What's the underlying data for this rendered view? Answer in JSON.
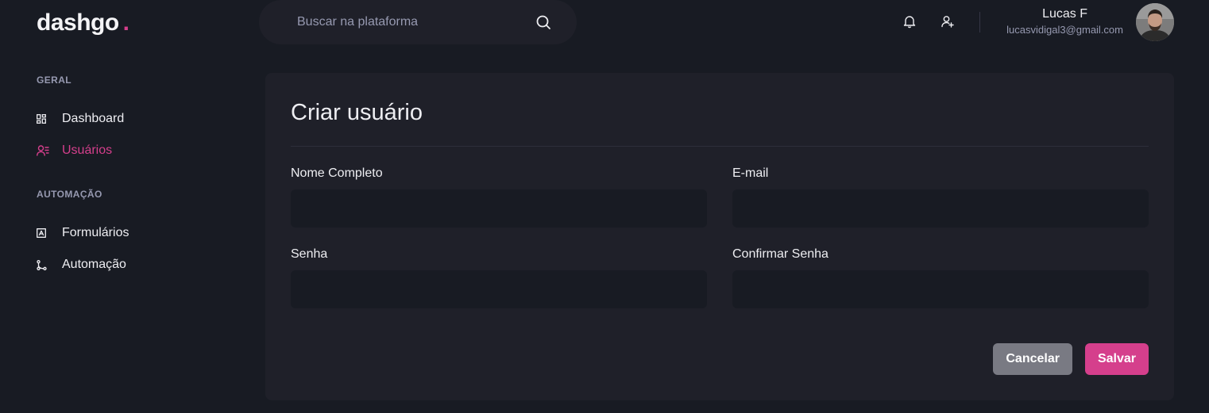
{
  "logo": {
    "text": "dashgo",
    "dot": "."
  },
  "search": {
    "placeholder": "Buscar na plataforma",
    "icon": "search-icon"
  },
  "header": {
    "icons": [
      "bell-icon",
      "user-add-icon"
    ]
  },
  "profile": {
    "name": "Lucas F",
    "email": "lucasvidigal3@gmail.com"
  },
  "sidebar": {
    "sections": [
      {
        "title": "GERAL",
        "items": [
          {
            "label": "Dashboard",
            "icon": "dashboard-icon"
          },
          {
            "label": "Usuários",
            "icon": "users-icon",
            "active": true
          }
        ]
      },
      {
        "title": "AUTOMAÇÃO",
        "items": [
          {
            "label": "Formulários",
            "icon": "form-icon"
          },
          {
            "label": "Automação",
            "icon": "git-branch-icon"
          }
        ]
      }
    ]
  },
  "form": {
    "title": "Criar usuário",
    "fields": {
      "name": {
        "label": "Nome Completo",
        "value": ""
      },
      "email": {
        "label": "E-mail",
        "value": ""
      },
      "password": {
        "label": "Senha",
        "value": ""
      },
      "password_confirm": {
        "label": "Confirmar Senha",
        "value": ""
      }
    },
    "cancel_label": "Cancelar",
    "save_label": "Salvar"
  },
  "colors": {
    "accent": "#d53f8c",
    "background": "#181b23",
    "card": "#1f2029",
    "muted": "#9699b0",
    "cancel": "#797a83"
  }
}
